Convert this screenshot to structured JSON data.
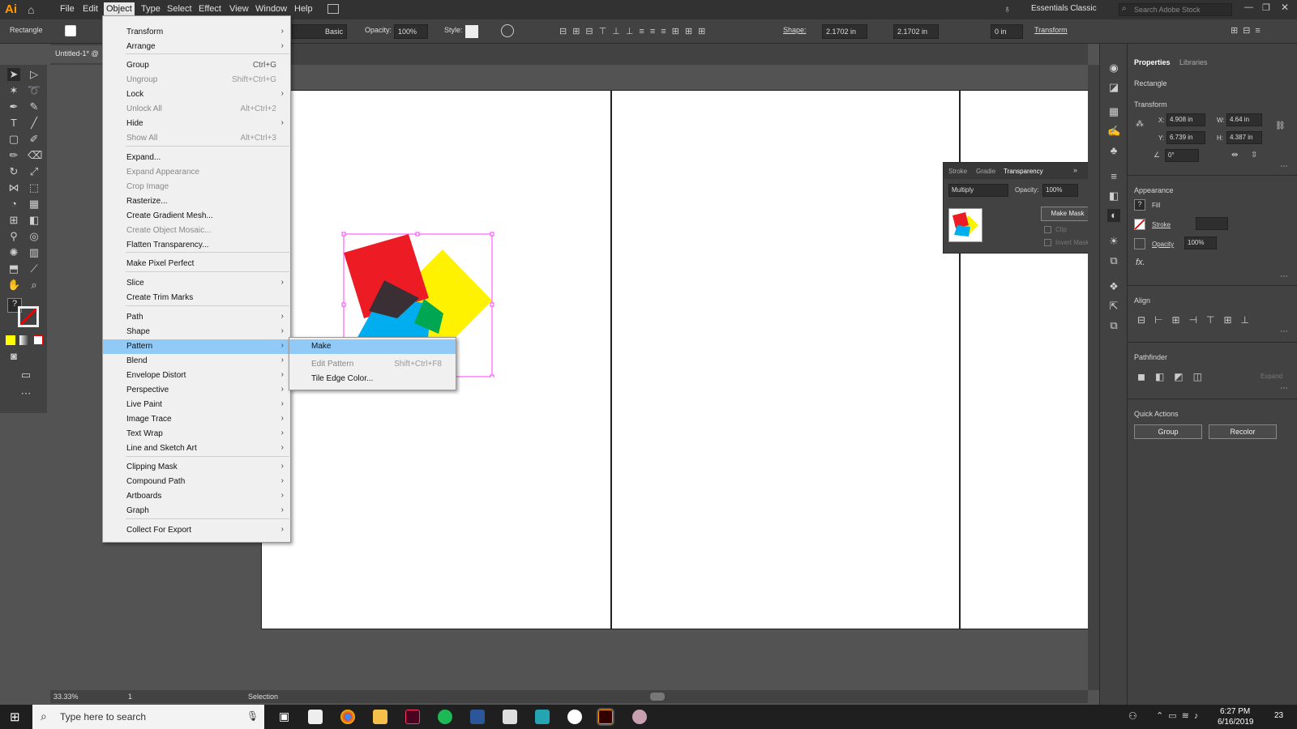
{
  "menubar": {
    "logo": "Ai",
    "items": [
      "File",
      "Edit",
      "Object",
      "Type",
      "Select",
      "Effect",
      "View",
      "Window",
      "Help"
    ],
    "workspace": "Essentials Classic",
    "search_placeholder": "Search Adobe Stock"
  },
  "control_bar": {
    "selection": "Rectangle",
    "stroke_style": "Basic",
    "opacity_label": "Opacity:",
    "opacity": "100%",
    "style_label": "Style:",
    "shape_label": "Shape:",
    "shape_w": "2.1702 in",
    "shape_h": "2.1702 in",
    "corner": "0 in",
    "transform_label": "Transform"
  },
  "document": {
    "tab": "Untitled-1* @",
    "zoom": "33.33%",
    "artboard": "1",
    "status": "Selection"
  },
  "object_menu": {
    "items": [
      {
        "label": "Transform",
        "sub": true
      },
      {
        "label": "Arrange",
        "sub": true
      },
      {
        "sep": true
      },
      {
        "label": "Group",
        "shortcut": "Ctrl+G"
      },
      {
        "label": "Ungroup",
        "shortcut": "Shift+Ctrl+G",
        "disabled": true
      },
      {
        "label": "Lock",
        "sub": true
      },
      {
        "label": "Unlock All",
        "shortcut": "Alt+Ctrl+2",
        "disabled": true
      },
      {
        "label": "Hide",
        "sub": true
      },
      {
        "label": "Show All",
        "shortcut": "Alt+Ctrl+3",
        "disabled": true
      },
      {
        "sep": true
      },
      {
        "label": "Expand..."
      },
      {
        "label": "Expand Appearance",
        "disabled": true
      },
      {
        "label": "Crop Image",
        "disabled": true
      },
      {
        "label": "Rasterize..."
      },
      {
        "label": "Create Gradient Mesh..."
      },
      {
        "label": "Create Object Mosaic...",
        "disabled": true
      },
      {
        "label": "Flatten Transparency..."
      },
      {
        "sep": true
      },
      {
        "label": "Make Pixel Perfect"
      },
      {
        "sep": true
      },
      {
        "label": "Slice",
        "sub": true
      },
      {
        "label": "Create Trim Marks"
      },
      {
        "sep": true
      },
      {
        "label": "Path",
        "sub": true
      },
      {
        "label": "Shape",
        "sub": true
      },
      {
        "label": "Pattern",
        "sub": true,
        "highlight": true
      },
      {
        "label": "Blend",
        "sub": true
      },
      {
        "label": "Envelope Distort",
        "sub": true
      },
      {
        "label": "Perspective",
        "sub": true
      },
      {
        "label": "Live Paint",
        "sub": true
      },
      {
        "label": "Image Trace",
        "sub": true
      },
      {
        "label": "Text Wrap",
        "sub": true
      },
      {
        "label": "Line and Sketch Art",
        "sub": true
      },
      {
        "sep": true
      },
      {
        "label": "Clipping Mask",
        "sub": true
      },
      {
        "label": "Compound Path",
        "sub": true
      },
      {
        "label": "Artboards",
        "sub": true
      },
      {
        "label": "Graph",
        "sub": true
      },
      {
        "sep": true
      },
      {
        "label": "Collect For Export",
        "sub": true
      }
    ]
  },
  "pattern_submenu": {
    "items": [
      {
        "label": "Make",
        "highlight": true
      },
      {
        "label": "Edit Pattern",
        "shortcut": "Shift+Ctrl+F8",
        "disabled": true
      },
      {
        "label": "Tile Edge Color..."
      }
    ]
  },
  "transparency_panel": {
    "tabs": [
      "Stroke",
      "Gradie",
      "Transparency"
    ],
    "mode": "Multiply",
    "opacity_label": "Opacity:",
    "opacity": "100%",
    "make_mask": "Make Mask",
    "clip": "Clip",
    "invert": "Invert Mask"
  },
  "properties": {
    "tabs": [
      "Properties",
      "Libraries"
    ],
    "selection": "Rectangle",
    "transform": "Transform",
    "x_label": "X:",
    "x": "4.908 in",
    "y_label": "Y:",
    "y": "6.739 in",
    "w_label": "W:",
    "w": "4.64 in",
    "h_label": "H:",
    "h": "4.387 in",
    "angle": "0°",
    "appearance": "Appearance",
    "fill": "Fill",
    "stroke": "Stroke",
    "opacity": "Opacity",
    "opacity_val": "100%",
    "fx": "fx.",
    "align": "Align",
    "pathfinder": "Pathfinder",
    "expand": "Expand",
    "quick_actions": "Quick Actions",
    "group_btn": "Group",
    "recolor_btn": "Recolor"
  },
  "taskbar": {
    "search": "Type here to search",
    "time": "6:27 PM",
    "date": "6/16/2019",
    "notif": "23"
  }
}
